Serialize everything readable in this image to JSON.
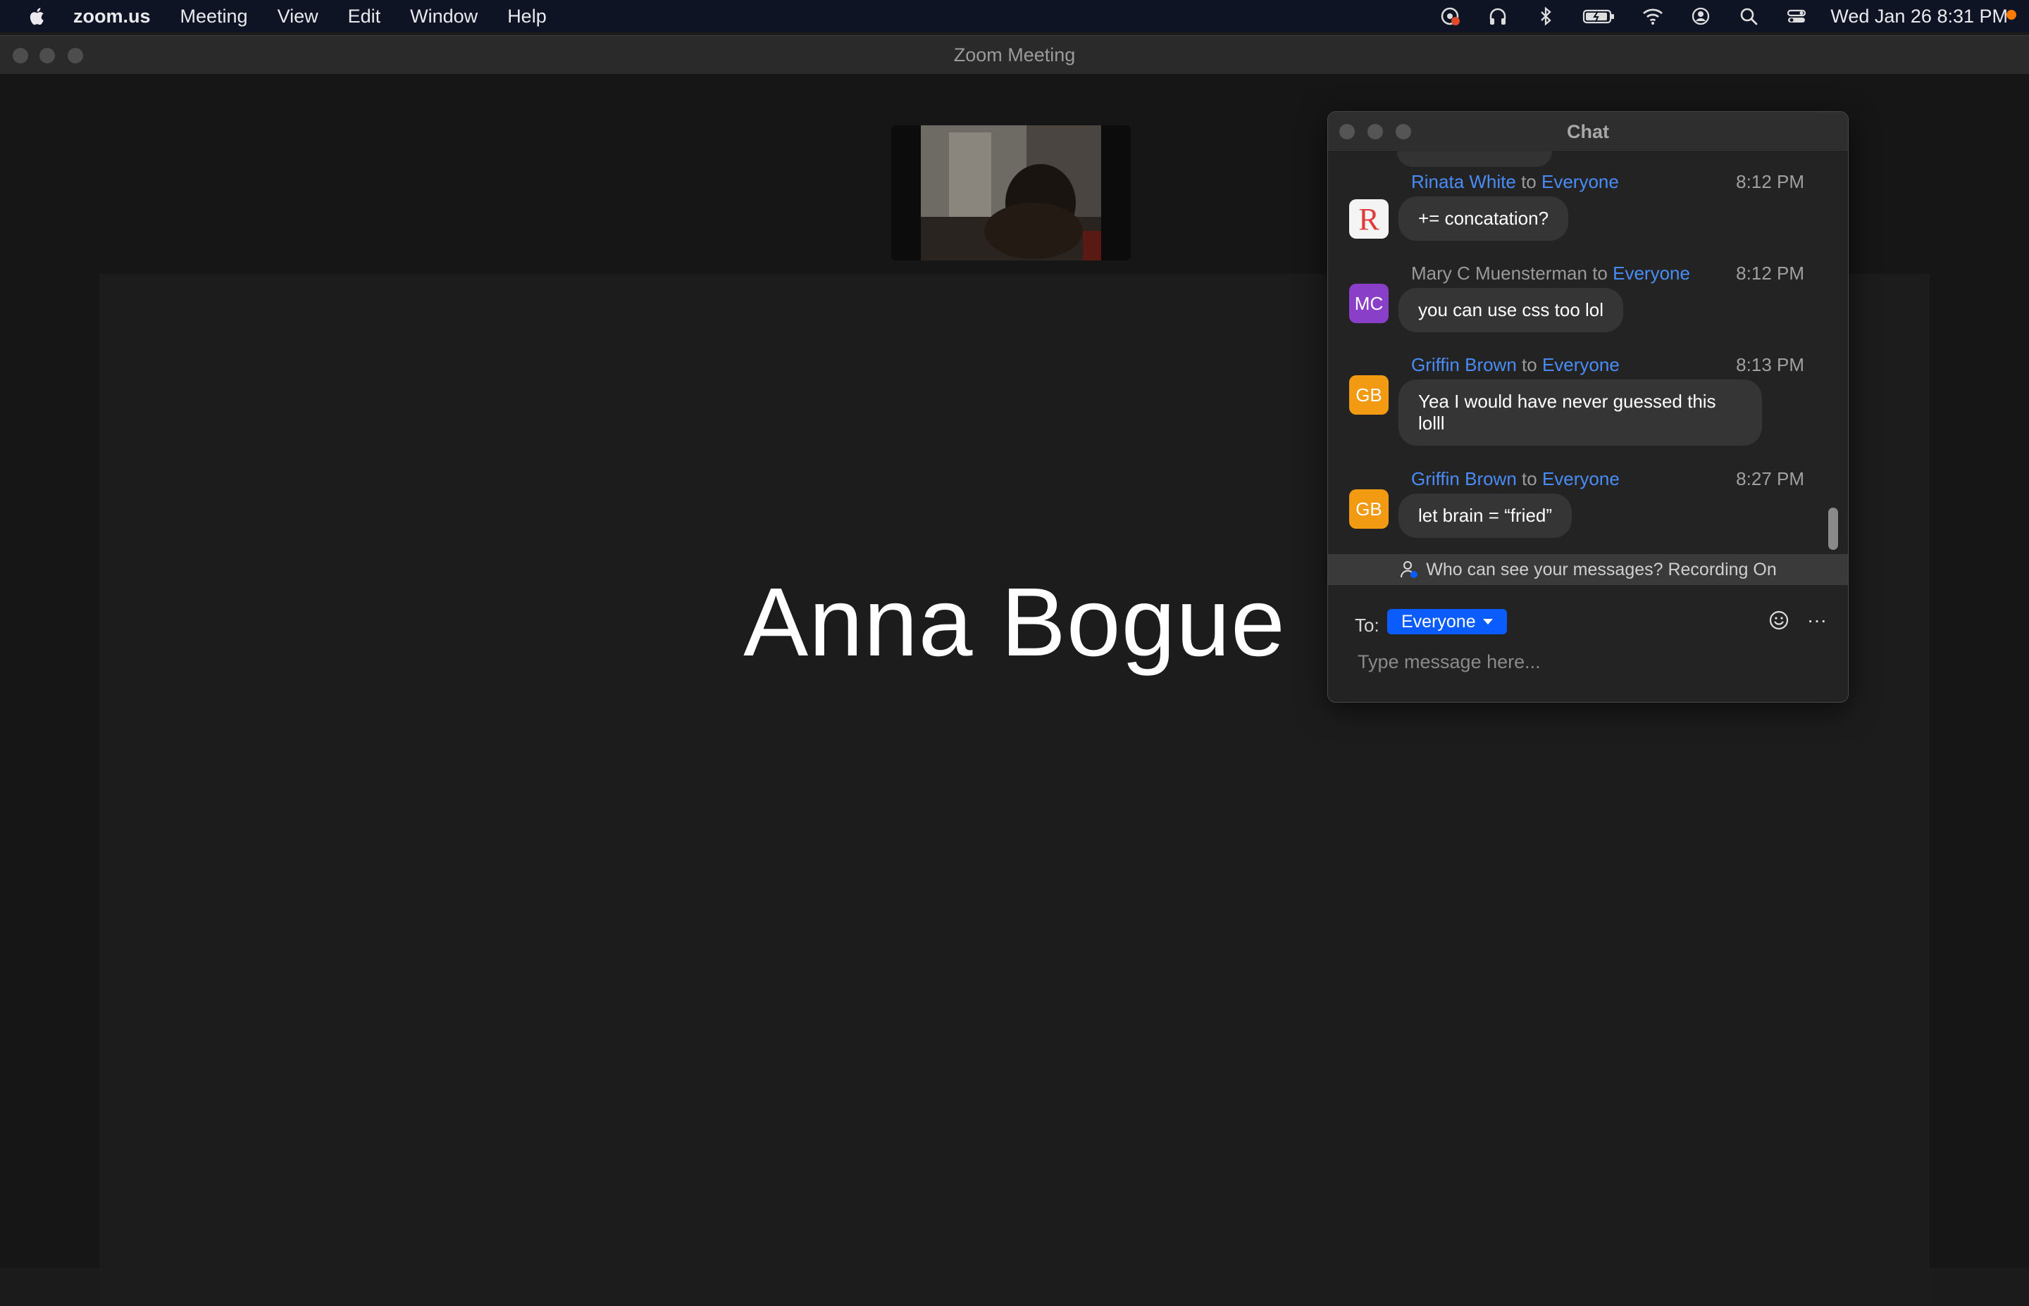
{
  "menubar": {
    "app_name": "zoom.us",
    "items": [
      "Meeting",
      "View",
      "Edit",
      "Window",
      "Help"
    ],
    "clock": "Wed Jan 26  8:31 PM",
    "status_icons": [
      "screen-recording-icon",
      "headphones-icon",
      "bluetooth-icon",
      "battery-icon",
      "wifi-icon",
      "user-account-icon",
      "spotlight-search-icon",
      "control-center-icon"
    ]
  },
  "window": {
    "title": "Zoom Meeting"
  },
  "meeting": {
    "speaker_name": "Anna Bogue"
  },
  "chat": {
    "title": "Chat",
    "to_word": "to",
    "messages": [
      {
        "sender": "Rinata White",
        "recipient": "Everyone",
        "time": "8:12 PM",
        "text": "+= concatation?",
        "avatar": "R",
        "avatar_color": "#f0f0f0",
        "sender_color": "#4a8cf7"
      },
      {
        "sender": "Mary C Muensterman",
        "recipient": "Everyone",
        "time": "8:12 PM",
        "text": "you can use css too lol",
        "avatar": "MC",
        "avatar_color": "#8a3fc9",
        "sender_color": "#9a9a9a"
      },
      {
        "sender": "Griffin Brown",
        "recipient": "Everyone",
        "time": "8:13 PM",
        "text": "Yea I would have never guessed this lolll",
        "avatar": "GB",
        "avatar_color": "#f29a12",
        "sender_color": "#4a8cf7"
      },
      {
        "sender": "Griffin Brown",
        "recipient": "Everyone",
        "time": "8:27 PM",
        "text": "let brain = “fried”",
        "avatar": "GB",
        "avatar_color": "#f29a12",
        "sender_color": "#4a8cf7"
      }
    ],
    "privacy_text": "Who can see your messages? Recording On",
    "to_label": "To:",
    "to_value": "Everyone",
    "more_label": "···",
    "input_placeholder": "Type message here..."
  }
}
